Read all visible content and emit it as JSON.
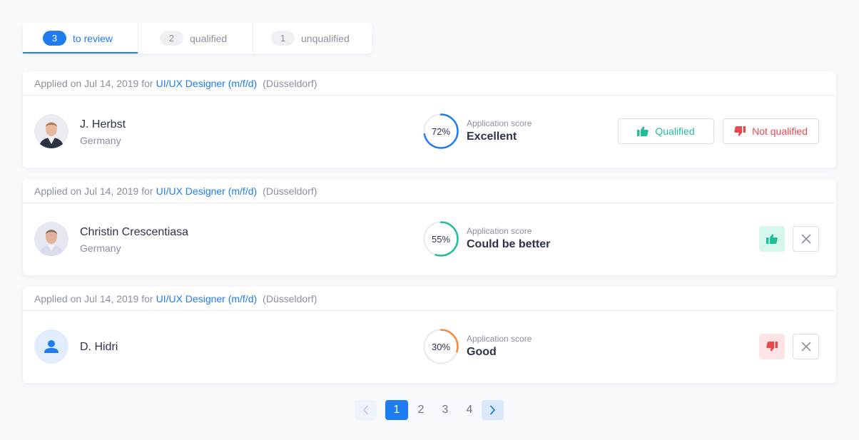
{
  "tabs": [
    {
      "count": "3",
      "label": "to review",
      "active": true
    },
    {
      "count": "2",
      "label": "qualified",
      "active": false
    },
    {
      "count": "1",
      "label": "unqualified",
      "active": false
    }
  ],
  "applications": [
    {
      "applied_prefix": "Applied on Jul 14, 2019 for",
      "job_title": "UI/UX Designer (m/f/d)",
      "location": "(Düsseldorf)",
      "name": "J. Herbst",
      "country": "Germany",
      "score_pct": "72%",
      "score_value": 72,
      "score_color": "#1e7cf0",
      "score_caption": "Application score",
      "score_text": "Excellent",
      "qualified_label": "Qualified",
      "not_qualified_label": "Not qualified"
    },
    {
      "applied_prefix": "Applied on Jul 14, 2019 for",
      "job_title": "UI/UX Designer (m/f/d)",
      "location": "(Düsseldorf)",
      "name": "Christin Crescentiasa",
      "country": "Germany",
      "score_pct": "55%",
      "score_value": 55,
      "score_color": "#1fbe98",
      "score_caption": "Application score",
      "score_text": "Could be better"
    },
    {
      "applied_prefix": "Applied on Jul 14, 2019 for",
      "job_title": "UI/UX Designer (m/f/d)",
      "location": "(Düsseldorf)",
      "name": "D. Hidri",
      "score_pct": "30%",
      "score_value": 30,
      "score_color": "#f08a3e",
      "score_caption": "Application score",
      "score_text": "Good"
    }
  ],
  "pagination": {
    "pages": [
      "1",
      "2",
      "3",
      "4"
    ],
    "current": "1"
  },
  "colors": {
    "accent": "#1e7cf0",
    "qualified_green": "#1fbe98",
    "reject_red": "#e8494d"
  }
}
